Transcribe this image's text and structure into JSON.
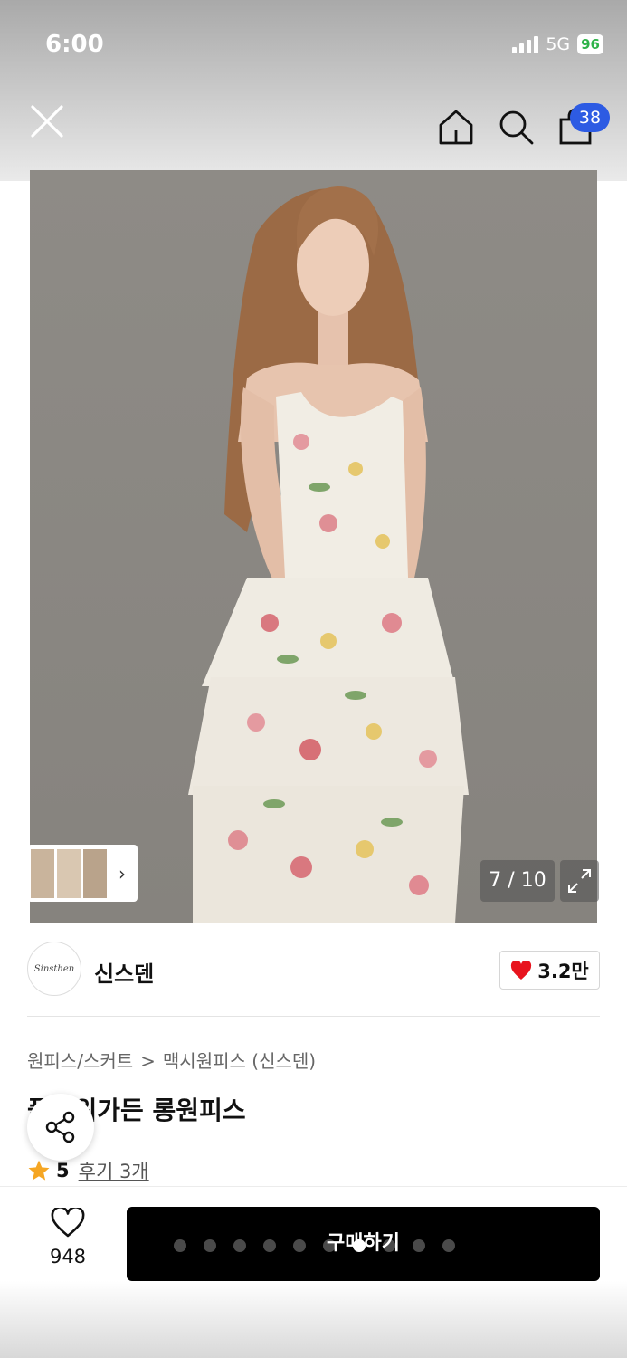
{
  "status_bar": {
    "time": "6:00",
    "network": "5G",
    "battery": "96"
  },
  "nav": {
    "cart_count": "38"
  },
  "gallery": {
    "page_counter": "7 / 10",
    "current_index": 7,
    "total": 10
  },
  "seller": {
    "name": "신스덴",
    "logo_text": "Sinsthen",
    "like_count": "3.2만"
  },
  "product": {
    "breadcrumb": [
      "원피스/스커트",
      "맥시원피스 (신스덴)"
    ],
    "title": "플라워가든 롱원피스",
    "rating": "5",
    "review_label": "후기 3개"
  },
  "bottom_bar": {
    "wish_count": "948",
    "buy_label": "구매하기",
    "dot_count": 10,
    "active_dot": 7
  },
  "colors": {
    "badge": "#2d5be3",
    "heart": "#e8141e",
    "star": "#f5a623",
    "buy_button": "#000000"
  },
  "icons": [
    "close-icon",
    "home-icon",
    "search-icon",
    "shopping-bag-icon",
    "expand-icon",
    "heart-icon",
    "share-icon",
    "star-icon",
    "chevron-right-icon"
  ]
}
